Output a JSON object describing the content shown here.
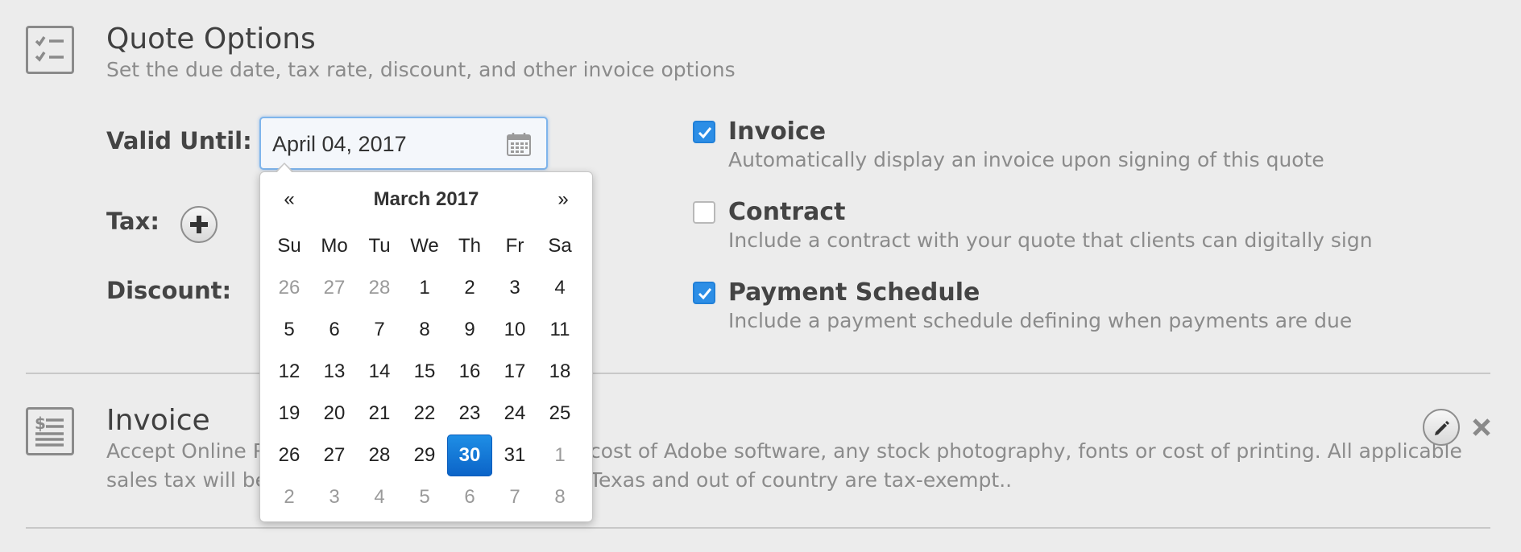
{
  "quote_options": {
    "title": "Quote Options",
    "subtitle": "Set the due date, tax rate, discount, and other invoice options",
    "icon": "checklist-icon"
  },
  "fields": {
    "valid_until_label": "Valid Until:",
    "valid_until_value": "April 04, 2017",
    "tax_label": "Tax:",
    "discount_label": "Discount:"
  },
  "options": [
    {
      "title": "Invoice",
      "desc": "Automatically display an invoice upon signing of this quote",
      "checked": true
    },
    {
      "title": "Contract",
      "desc": "Include a contract with your quote that clients can digitally sign",
      "checked": false
    },
    {
      "title": "Payment Schedule",
      "desc": "Include a payment schedule defining when payments are due",
      "checked": true
    }
  ],
  "invoice_section": {
    "title": "Invoice",
    "line1_left": "Accept Online Pa",
    "line1_right": "cost of Adobe software, any stock photography, fonts or cost of printing. All applicable",
    "line2_left": "sales tax will be p",
    "line2_right": "Texas and out of country are tax-exempt..",
    "icon": "invoice-icon"
  },
  "datepicker": {
    "prev": "«",
    "next": "»",
    "month": "March 2017",
    "weekdays": [
      "Su",
      "Mo",
      "Tu",
      "We",
      "Th",
      "Fr",
      "Sa"
    ],
    "weeks": [
      [
        "26",
        "27",
        "28",
        "1",
        "2",
        "3",
        "4"
      ],
      [
        "5",
        "6",
        "7",
        "8",
        "9",
        "10",
        "11"
      ],
      [
        "12",
        "13",
        "14",
        "15",
        "16",
        "17",
        "18"
      ],
      [
        "19",
        "20",
        "21",
        "22",
        "23",
        "24",
        "25"
      ],
      [
        "26",
        "27",
        "28",
        "29",
        "30",
        "31",
        "1"
      ],
      [
        "2",
        "3",
        "4",
        "5",
        "6",
        "7",
        "8"
      ]
    ],
    "selected": "30"
  },
  "colors": {
    "accent": "#2c8ee6",
    "selected_day": "#0b63c7",
    "background": "#ececec"
  }
}
